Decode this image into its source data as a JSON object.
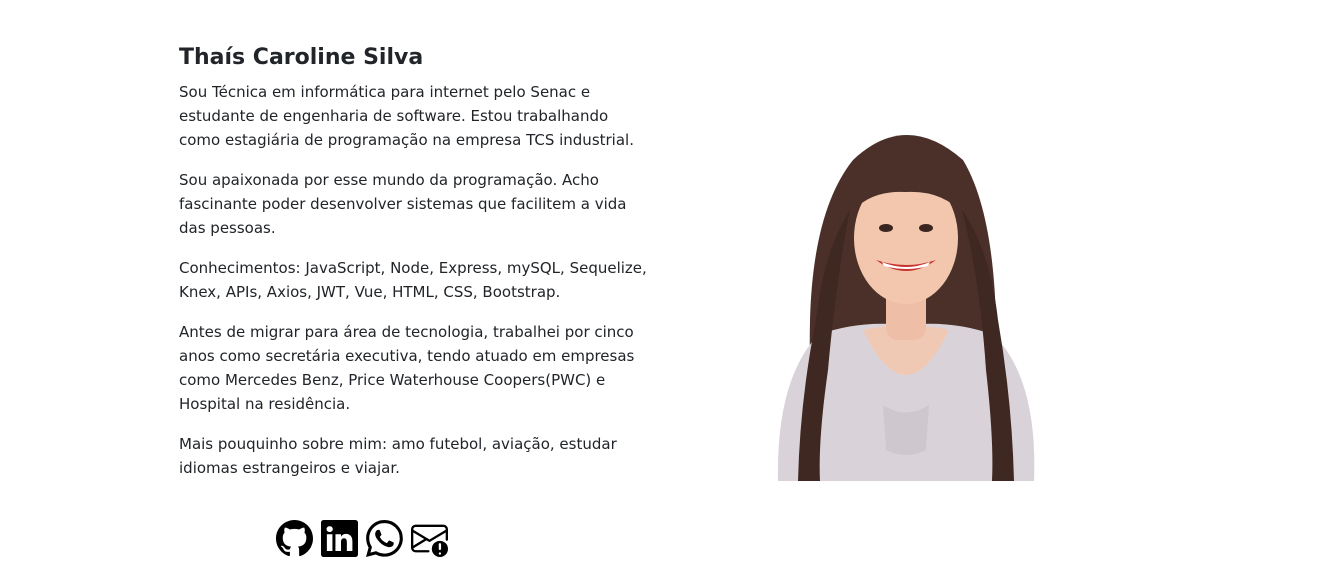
{
  "profile": {
    "name": "Thaís Caroline Silva",
    "paragraphs": [
      "Sou Técnica em informática para internet pelo Senac e estudante de engenharia de software. Estou trabalhando como estagiária de programação na empresa TCS industrial.",
      "Sou apaixonada por esse mundo da programação. Acho fascinante poder desenvolver sistemas que facilitem a vida das pessoas.",
      "Conhecimentos: JavaScript, Node, Express, mySQL, Sequelize, Knex, APIs, Axios, JWT, Vue, HTML, CSS, Bootstrap.",
      "Antes de migrar para área de tecnologia, trabalhei por cinco anos como secretária executiva, tendo atuado em empresas como Mercedes Benz, Price Waterhouse Coopers(PWC) e Hospital na residência.",
      "Mais pouquinho sobre mim: amo futebol, aviação, estudar idiomas estrangeiros e viajar."
    ]
  },
  "social": [
    {
      "icon": "github-icon"
    },
    {
      "icon": "linkedin-icon"
    },
    {
      "icon": "whatsapp-icon"
    },
    {
      "icon": "email-icon"
    }
  ],
  "colors": {
    "text": "#212529",
    "icon": "#000000",
    "background": "#ffffff"
  }
}
